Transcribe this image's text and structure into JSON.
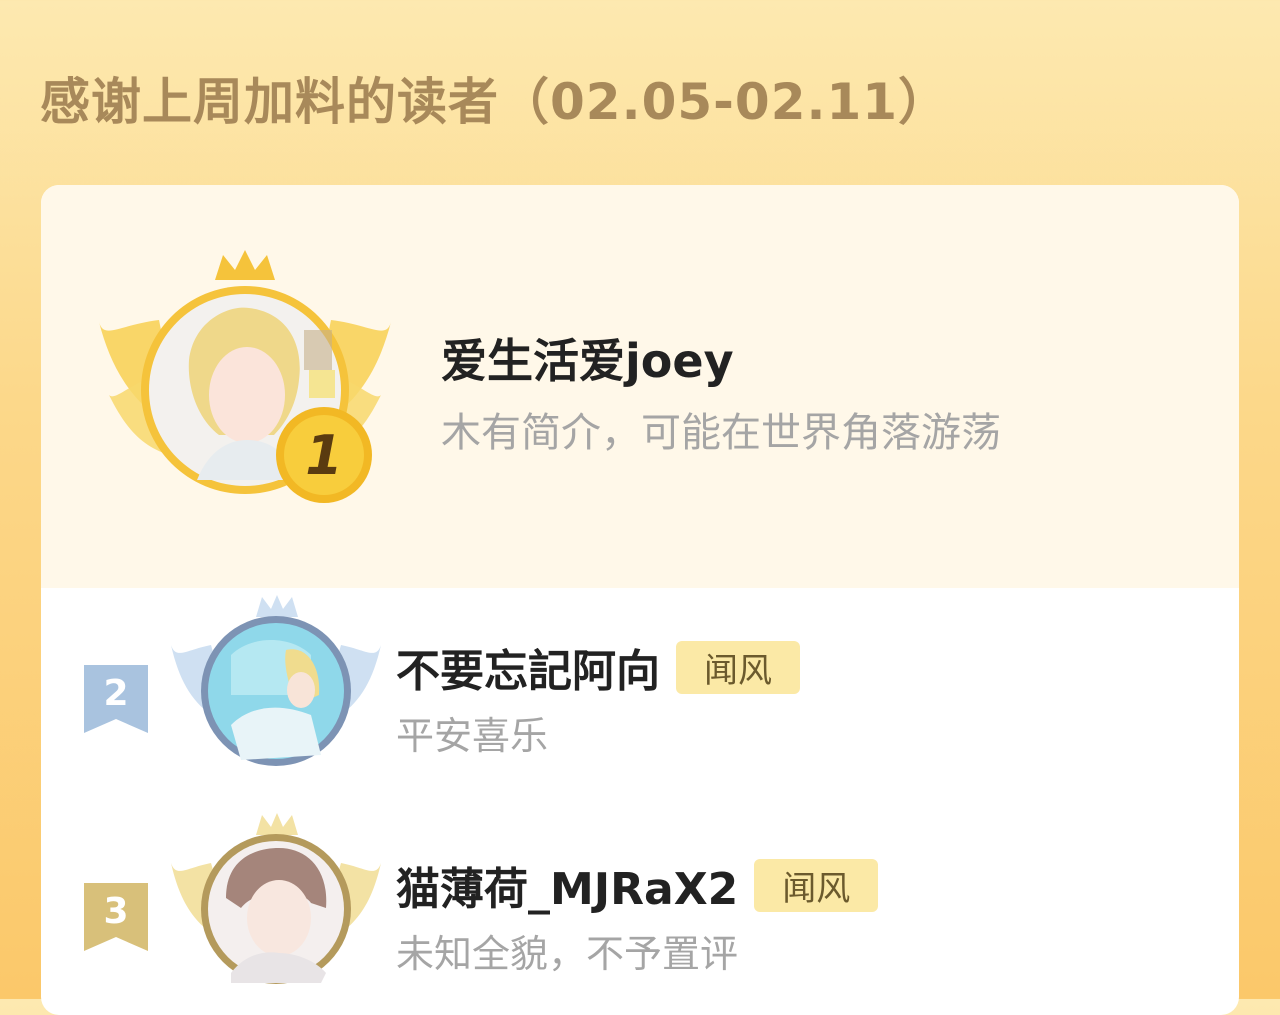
{
  "header": {
    "title": "感谢上周加料的读者（02.05-02.11）"
  },
  "colors": {
    "gold": "#f5c33b",
    "silver": "#a9c3df",
    "bronze": "#d8c07a",
    "tag_bg": "#fbe9a6"
  },
  "leaderboard": {
    "first": {
      "rank": "1",
      "name": "爱生活爱joey",
      "bio": "木有简介，可能在世界角落游荡",
      "avatar_icon": "avatar-blonde-hood"
    },
    "others": [
      {
        "rank": "2",
        "name": "不要忘記阿向",
        "tag": "闻风",
        "bio": "平安喜乐",
        "avatar_icon": "avatar-blonde-water"
      },
      {
        "rank": "3",
        "name": "猫薄荷_MJRaX2",
        "tag": "闻风",
        "bio": "未知全貌，不予置评",
        "avatar_icon": "avatar-brown-hair"
      }
    ]
  }
}
